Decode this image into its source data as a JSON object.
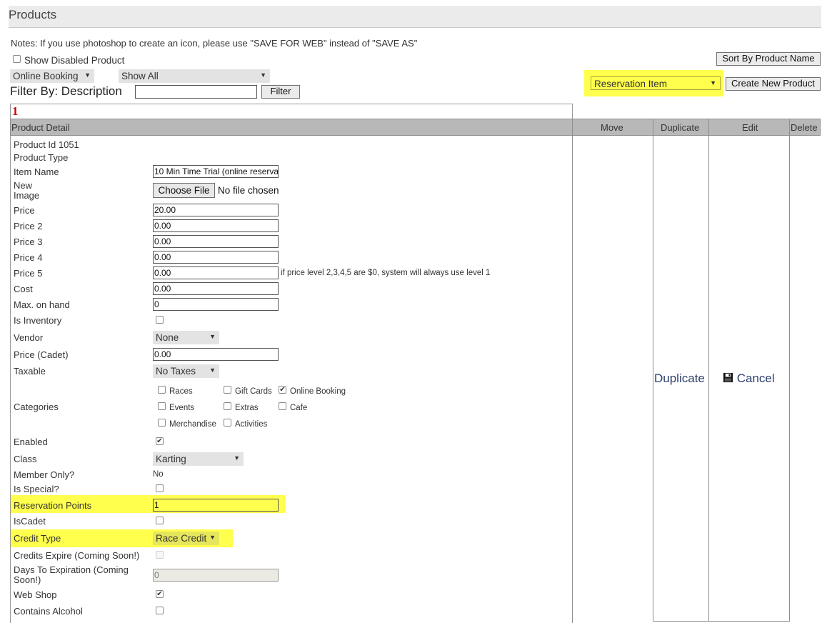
{
  "page": {
    "title": "Products"
  },
  "notes": "Notes: If you use photoshop to create an icon, please use \"SAVE FOR WEB\" instead of \"SAVE AS\"",
  "filters": {
    "show_disabled_label": "Show Disabled Product",
    "category_select": "Online Booking",
    "status_select": "Show All",
    "filter_by_label": "Filter By: Description",
    "description_value": "",
    "filter_button": "Filter"
  },
  "toolbar": {
    "sort_button": "Sort By Product Name",
    "product_type_select": "Reservation Item",
    "create_button": "Create New Product"
  },
  "pagination": {
    "current": "1"
  },
  "columns": [
    "Product Detail",
    "Move",
    "Duplicate",
    "Edit",
    "Delete"
  ],
  "product": {
    "product_id_label": "Product Id 1051",
    "product_type_label": "Product Type",
    "item_name_label": "Item Name",
    "item_name_value": "10 Min Time Trial (online reservat",
    "new_image_label_1": "New",
    "new_image_label_2": "Image",
    "choose_file_button": "Choose File",
    "no_file_text": "No file chosen",
    "price_label": "Price",
    "price_value": "20.00",
    "price2_label": "Price 2",
    "price2_value": "0.00",
    "price3_label": "Price 3",
    "price3_value": "0.00",
    "price4_label": "Price 4",
    "price4_value": "0.00",
    "price5_label": "Price 5",
    "price5_value": "0.00",
    "price_note": "if price level 2,3,4,5 are $0, system will always use level 1",
    "cost_label": "Cost",
    "cost_value": "0.00",
    "max_on_hand_label": "Max. on hand",
    "max_on_hand_value": "0",
    "is_inventory_label": "Is Inventory",
    "vendor_label": "Vendor",
    "vendor_value": "None",
    "price_cadet_label": "Price (Cadet)",
    "price_cadet_value": "0.00",
    "taxable_label": "Taxable",
    "taxable_value": "No Taxes",
    "categories_label": "Categories",
    "categories": {
      "races": "Races",
      "gift_cards": "Gift Cards",
      "online_booking": "Online Booking",
      "events": "Events",
      "extras": "Extras",
      "cafe": "Cafe",
      "merchandise": "Merchandise",
      "activities": "Activities"
    },
    "enabled_label": "Enabled",
    "class_label": "Class",
    "class_value": "Karting",
    "member_only_label": "Member Only?",
    "member_only_value": "No",
    "is_special_label": "Is Special?",
    "reservation_points_label": "Reservation Points",
    "reservation_points_value": "1",
    "iscadet_label": "IsCadet",
    "credit_type_label": "Credit Type",
    "credit_type_value": "Race Credit",
    "credits_expire_label": "Credits Expire (Coming Soon!)",
    "days_to_expiration_label_1": "Days To Expiration (Coming",
    "days_to_expiration_label_2": "Soon!)",
    "days_to_expiration_value": "0",
    "web_shop_label": "Web Shop",
    "contains_alcohol_label": "Contains Alcohol"
  },
  "actions": {
    "duplicate": "Duplicate",
    "cancel": "Cancel"
  },
  "icons": {
    "dropdown": "chevron-down-icon",
    "save": "floppy-disk-icon"
  }
}
